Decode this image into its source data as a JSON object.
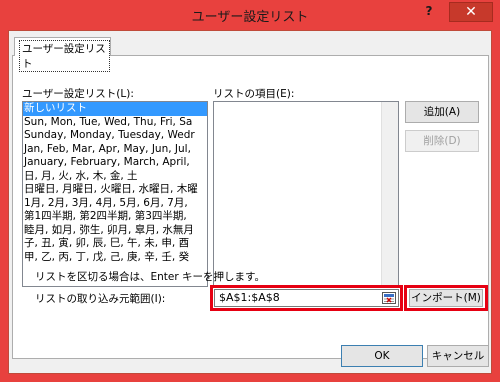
{
  "window": {
    "title": "ユーザー設定リスト",
    "help_glyph": "?",
    "close_glyph": "✕"
  },
  "tab": {
    "label": "ユーザー設定リスト"
  },
  "list_label": "ユーザー設定リスト(L):",
  "entries_label": "リストの項目(E):",
  "lists": [
    "新しいリスト",
    "Sun, Mon, Tue, Wed, Thu, Fri, Sa",
    "Sunday, Monday, Tuesday, Wedr",
    "Jan, Feb, Mar, Apr, May, Jun, Jul,",
    "January, February, March, April,",
    "日, 月, 火, 水, 木, 金, 土",
    "日曜日, 月曜日, 火曜日, 水曜日, 木曜",
    "1月, 2月, 3月, 4月, 5月, 6月, 7月,",
    "第1四半期, 第2四半期, 第3四半期,",
    "睦月, 如月, 弥生, 卯月, 皐月, 水無月",
    "子, 丑, 寅, 卯, 辰, 巳, 午, 未, 申, 酉",
    "甲, 乙, 丙, 丁, 戊, 己, 庚, 辛, 壬, 癸"
  ],
  "selected_index": 0,
  "buttons": {
    "add": "追加(A)",
    "delete": "削除(D)",
    "import": "インポート(M)",
    "ok": "OK",
    "cancel": "キャンセル"
  },
  "separator_hint": "リストを区切る場合は、Enter キーを押します。",
  "import_range_label": "リストの取り込み元範囲(I):",
  "import_range_value": "$A$1:$A$8",
  "highlight_color": "#e60012"
}
